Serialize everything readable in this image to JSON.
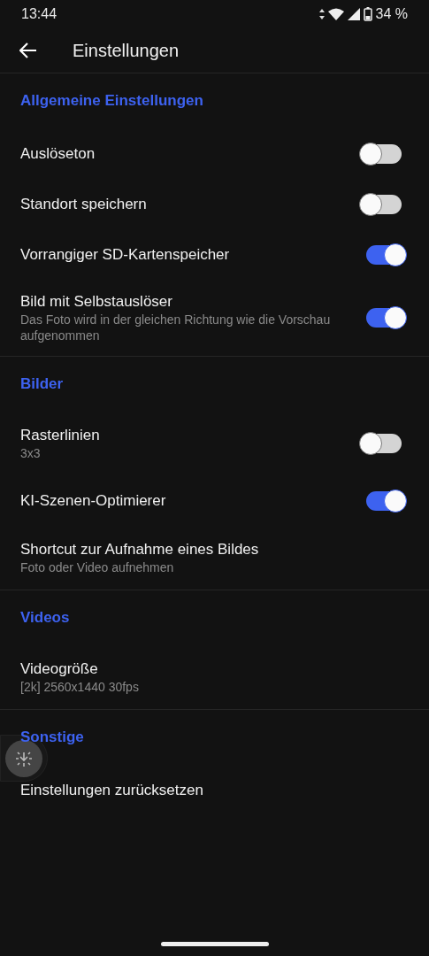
{
  "status_bar": {
    "time": "13:44",
    "battery": "34 %"
  },
  "header": {
    "title": "Einstellungen"
  },
  "sections": [
    {
      "title": "Allgemeine Einstellungen",
      "items": [
        {
          "kind": "toggle",
          "label": "Auslöseton",
          "on": false
        },
        {
          "kind": "toggle",
          "label": "Standort speichern",
          "on": false
        },
        {
          "kind": "toggle",
          "label": "Vorrangiger SD-Kartenspeicher",
          "on": true
        },
        {
          "kind": "toggle",
          "label": "Bild mit Selbstauslöser",
          "subtitle": "Das Foto wird in der gleichen Richtung wie die Vorschau aufgenommen",
          "on": true
        }
      ]
    },
    {
      "title": "Bilder",
      "items": [
        {
          "kind": "toggle",
          "label": "Rasterlinien",
          "subtitle": "3x3",
          "on": false
        },
        {
          "kind": "toggle",
          "label": "KI-Szenen-Optimierer",
          "on": true
        },
        {
          "kind": "link",
          "label": "Shortcut zur Aufnahme eines Bildes",
          "subtitle": "Foto oder Video aufnehmen"
        }
      ]
    },
    {
      "title": "Videos",
      "items": [
        {
          "kind": "link",
          "label": "Videogröße",
          "subtitle": "[2k] 2560x1440 30fps"
        }
      ]
    },
    {
      "title": "Sonstige",
      "items": [
        {
          "kind": "link",
          "label": "Einstellungen zurücksetzen"
        }
      ]
    }
  ]
}
